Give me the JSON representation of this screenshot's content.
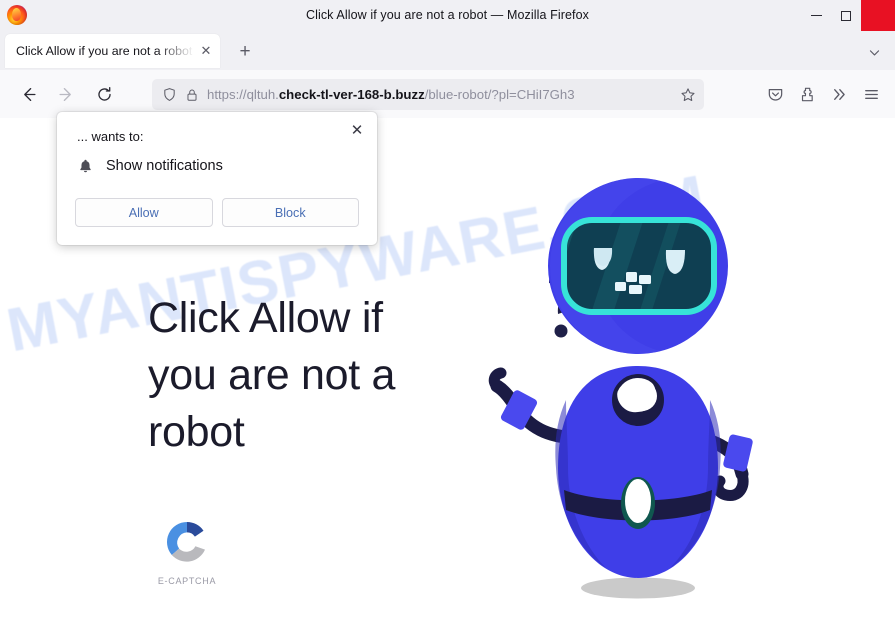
{
  "window": {
    "title": "Click Allow if you are not a robot — Mozilla Firefox",
    "minimize_label": "Minimize",
    "maximize_label": "Maximize",
    "close_label": "✕"
  },
  "tabs": {
    "active_title": "Click Allow if you are not a robot",
    "close_glyph": "✕",
    "new_tab_glyph": "+"
  },
  "nav": {
    "back_label": "Back",
    "forward_label": "Forward",
    "reload_label": "Reload"
  },
  "urlbar": {
    "scheme": "https://qltuh.",
    "domain": "check-tl-ver-168-b.buzz",
    "path": "/blue-robot/?pl=CHiI7Gh3",
    "full_url": "https://qltuh.check-tl-ver-168-b.buzz/blue-robot/?pl=CHiI7Gh3"
  },
  "toolbar": {
    "pocket_label": "Save to Pocket",
    "extensions_label": "Extensions",
    "overflow_glyph": "»",
    "menu_label": "Open application menu"
  },
  "popup": {
    "wants_to": "... wants to:",
    "permission": "Show notifications",
    "allow_label": "Allow",
    "block_label": "Block",
    "close_glyph": "✕",
    "icon": "bell-icon"
  },
  "page": {
    "headline": "Click Allow if you are not a robot",
    "watermark": "MYANTISPYWARE.COM",
    "captcha_label": "E-CAPTCHA",
    "robot_alt": "blue-robot-illustration",
    "question_marks": "??"
  },
  "colors": {
    "accent_blue": "#3d3ce0",
    "robot_body": "#3f3ee8",
    "robot_dark": "#1b1b44",
    "visor_border": "#37e3d8",
    "visor_fill": "#0f3f52",
    "watermark": "#dce6fb",
    "close_button": "#e81123",
    "popup_button_text": "#4a6fb5",
    "captcha_blue_dark": "#2a4b9b",
    "captcha_blue_light": "#4a90e2",
    "captcha_gray": "#b9b9bd"
  }
}
